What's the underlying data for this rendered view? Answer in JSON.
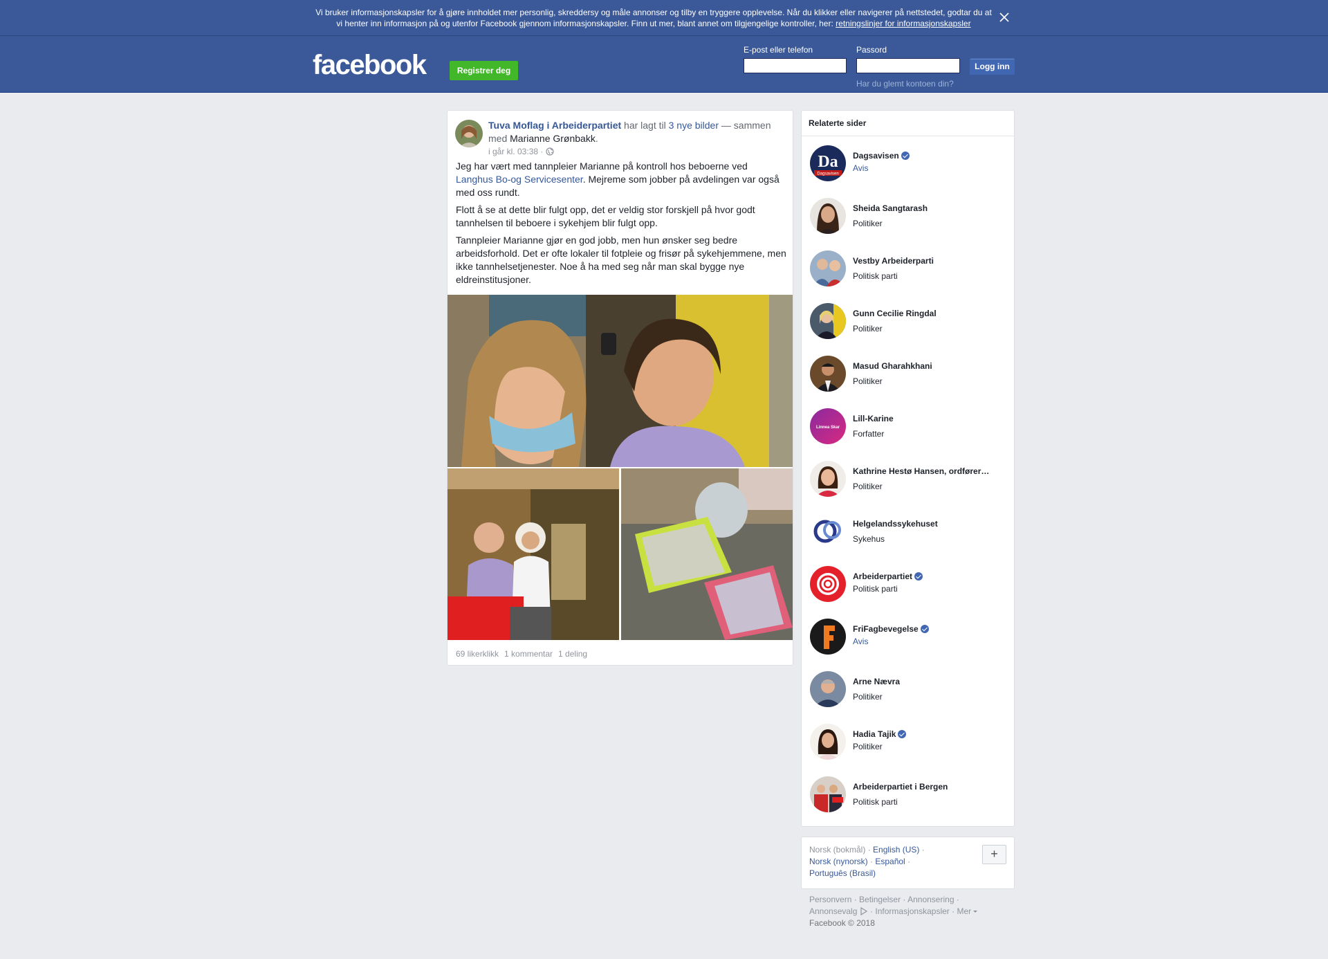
{
  "cookie_banner": {
    "text": "Vi bruker informasjonskapsler for å gjøre innholdet mer personlig, skreddersy og måle annonser og tilby en tryggere opplevelse. Når du klikker eller navigerer på nettstedet, godtar du at vi henter inn informasjon på og utenfor Facebook gjennom informasjonskapsler. Finn ut mer, blant annet om tilgjengelige kontroller, her: ",
    "link": "retningslinjer for informasjonskapsler",
    "close_icon": "close-icon"
  },
  "header": {
    "logo": "facebook",
    "register_label": "Registrer deg",
    "email_label": "E-post eller telefon",
    "password_label": "Passord",
    "login_label": "Logg inn",
    "forgot_label": "Har du glemt kontoen din?"
  },
  "post": {
    "author": "Tuva Moflag i Arbeiderpartiet",
    "action_prefix": " har lagt til ",
    "action_link": "3 nye bilder",
    "action_suffix": " — sammen med ",
    "tagged": "Marianne Grønbakk",
    "tagged_end": ".",
    "time": "i går kl. 03:38 ·",
    "privacy_icon": "globe-icon",
    "p1_a": "Jeg har vært med tannpleier Marianne på kontroll hos beboerne ved ",
    "p1_link": "Langhus Bo-og Servicesenter",
    "p1_b": ". Mejreme som jobber på avdelingen var også med oss rundt.",
    "p2": "Flott å se at dette blir fulgt opp, det er veldig stor forskjell på hvor godt tannhelsen til beboere i sykehjem blir fulgt opp.",
    "p3": "Tannpleier Marianne gjør en god jobb, men hun ønsker seg bedre arbeidsforhold. Det er ofte lokaler til fotpleie og frisør på sykehjemmene, men ikke tannhelsetjenester. Noe å ha med seg når man skal bygge nye eldreinstitusjoner.",
    "likes": "69 likerklikk",
    "comments": "1 kommentar",
    "shares": "1 deling"
  },
  "related": {
    "title": "Relaterte sider",
    "items": [
      {
        "name": "Dagsavisen",
        "category": "Avis",
        "verified": true,
        "link": true
      },
      {
        "name": "Sheida Sangtarash",
        "category": "Politiker",
        "verified": false,
        "link": false
      },
      {
        "name": "Vestby Arbeiderparti",
        "category": "Politisk parti",
        "verified": false,
        "link": false
      },
      {
        "name": "Gunn Cecilie Ringdal",
        "category": "Politiker",
        "verified": false,
        "link": false
      },
      {
        "name": "Masud Gharahkhani",
        "category": "Politiker",
        "verified": false,
        "link": false
      },
      {
        "name": "Lill-Karine",
        "category": "Forfatter",
        "verified": false,
        "link": false
      },
      {
        "name": "Kathrine Hestø Hansen, ordfører…",
        "category": "Politiker",
        "verified": false,
        "link": false
      },
      {
        "name": "Helgelandssykehuset",
        "category": "Sykehus",
        "verified": false,
        "link": false
      },
      {
        "name": "Arbeiderpartiet",
        "category": "Politisk parti",
        "verified": true,
        "link": false
      },
      {
        "name": "FriFagbevegelse",
        "category": "Avis",
        "verified": true,
        "link": true
      },
      {
        "name": "Arne Nævra",
        "category": "Politiker",
        "verified": false,
        "link": false
      },
      {
        "name": "Hadia Tajik",
        "category": "Politiker",
        "verified": true,
        "link": false
      },
      {
        "name": "Arbeiderpartiet i Bergen",
        "category": "Politisk parti",
        "verified": false,
        "link": false
      }
    ],
    "avatar_labels": {
      "dagsavisen": "Da",
      "dagsavisen_sub": "Dagsavisen",
      "lill": "Linnea Skar"
    }
  },
  "languages": {
    "current": "Norsk (bokmål)",
    "options": [
      "English (US)",
      "Norsk (nynorsk)",
      "Español",
      "Português (Brasil)"
    ],
    "add_label": "+"
  },
  "footer": {
    "links": [
      "Personvern",
      "Betingelser",
      "Annonsering",
      "Annonsevalg",
      "Informasjonskapsler",
      "Mer"
    ],
    "copyright": "Facebook © 2018"
  }
}
